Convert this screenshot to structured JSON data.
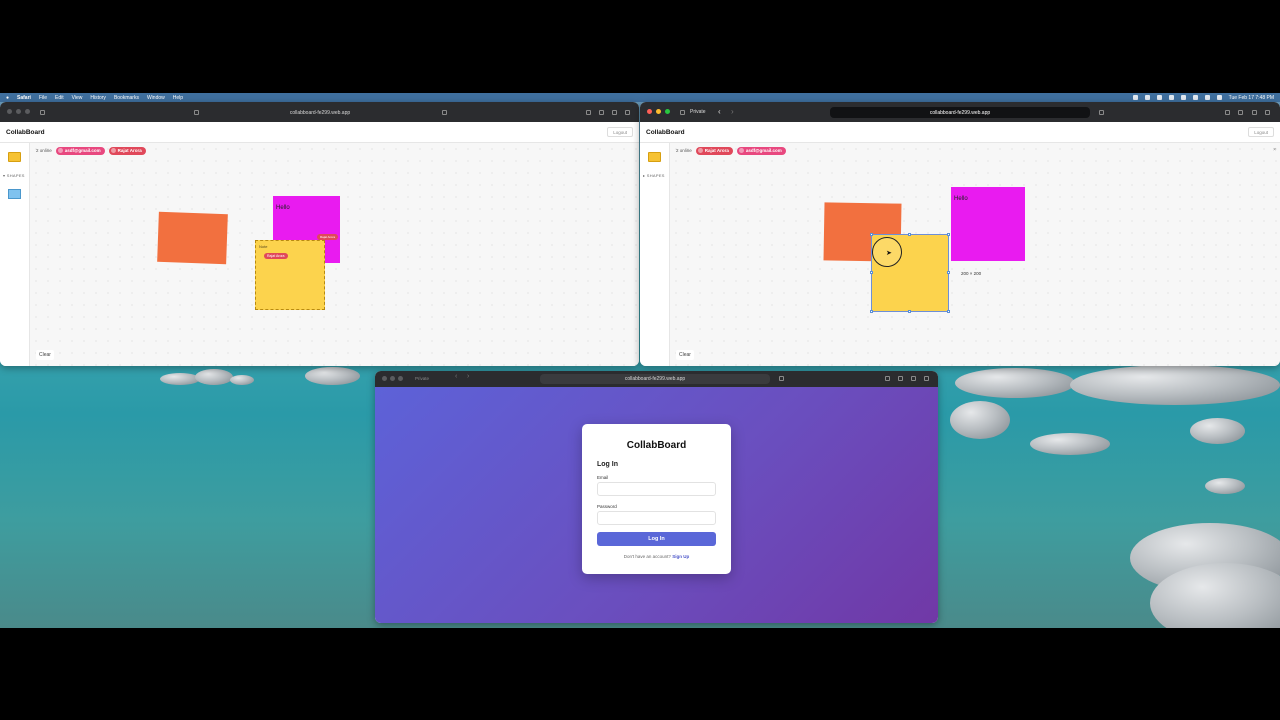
{
  "menubar": {
    "apple_icon": "apple-icon",
    "app": "Safari",
    "items": [
      "File",
      "Edit",
      "View",
      "History",
      "Bookmarks",
      "Window",
      "Help"
    ],
    "clock": "Tue Feb 17  7:48 PM"
  },
  "left_window": {
    "url": "collabboard-fe299.web.app",
    "app_title": "CollabBoard",
    "logout": "Logout",
    "online_count": "2 online",
    "users": [
      "asdf@gmail.com",
      "Rajat Arora"
    ],
    "shapes_label": "SHAPES",
    "clear": "Clear",
    "sticky_yellow_label": "Note",
    "sticky_magenta_text": "Hello",
    "cursor_name": "Rajat Arora",
    "cursor_name_small": "Rajat Arora"
  },
  "right_window": {
    "private_label": "Private",
    "url": "collabboard-fe299.web.app",
    "app_title": "CollabBoard",
    "logout": "Logout",
    "online_count": "2 online",
    "users": [
      "Rajat Arora",
      "asdf@gmail.com"
    ],
    "shapes_label": "SHAPES",
    "clear": "Clear",
    "sticky_magenta_text": "Hello",
    "dimensions": "200 × 200"
  },
  "login_window": {
    "private_label": "Private",
    "url": "collabboard-fe299.web.app",
    "app_title": "CollabBoard",
    "heading": "Log In",
    "email_label": "Email",
    "password_label": "Password",
    "submit": "Log In",
    "footer_text": "Don't have an account?",
    "signup": "Sign Up"
  },
  "colors": {
    "sticky_yellow": "#fcd34d",
    "sticky_magenta": "#e91bf0",
    "shape_orange": "#f2703f",
    "pill_pink": "#e8487f",
    "pill_red": "#e0485a",
    "primary": "#5a67d8"
  }
}
